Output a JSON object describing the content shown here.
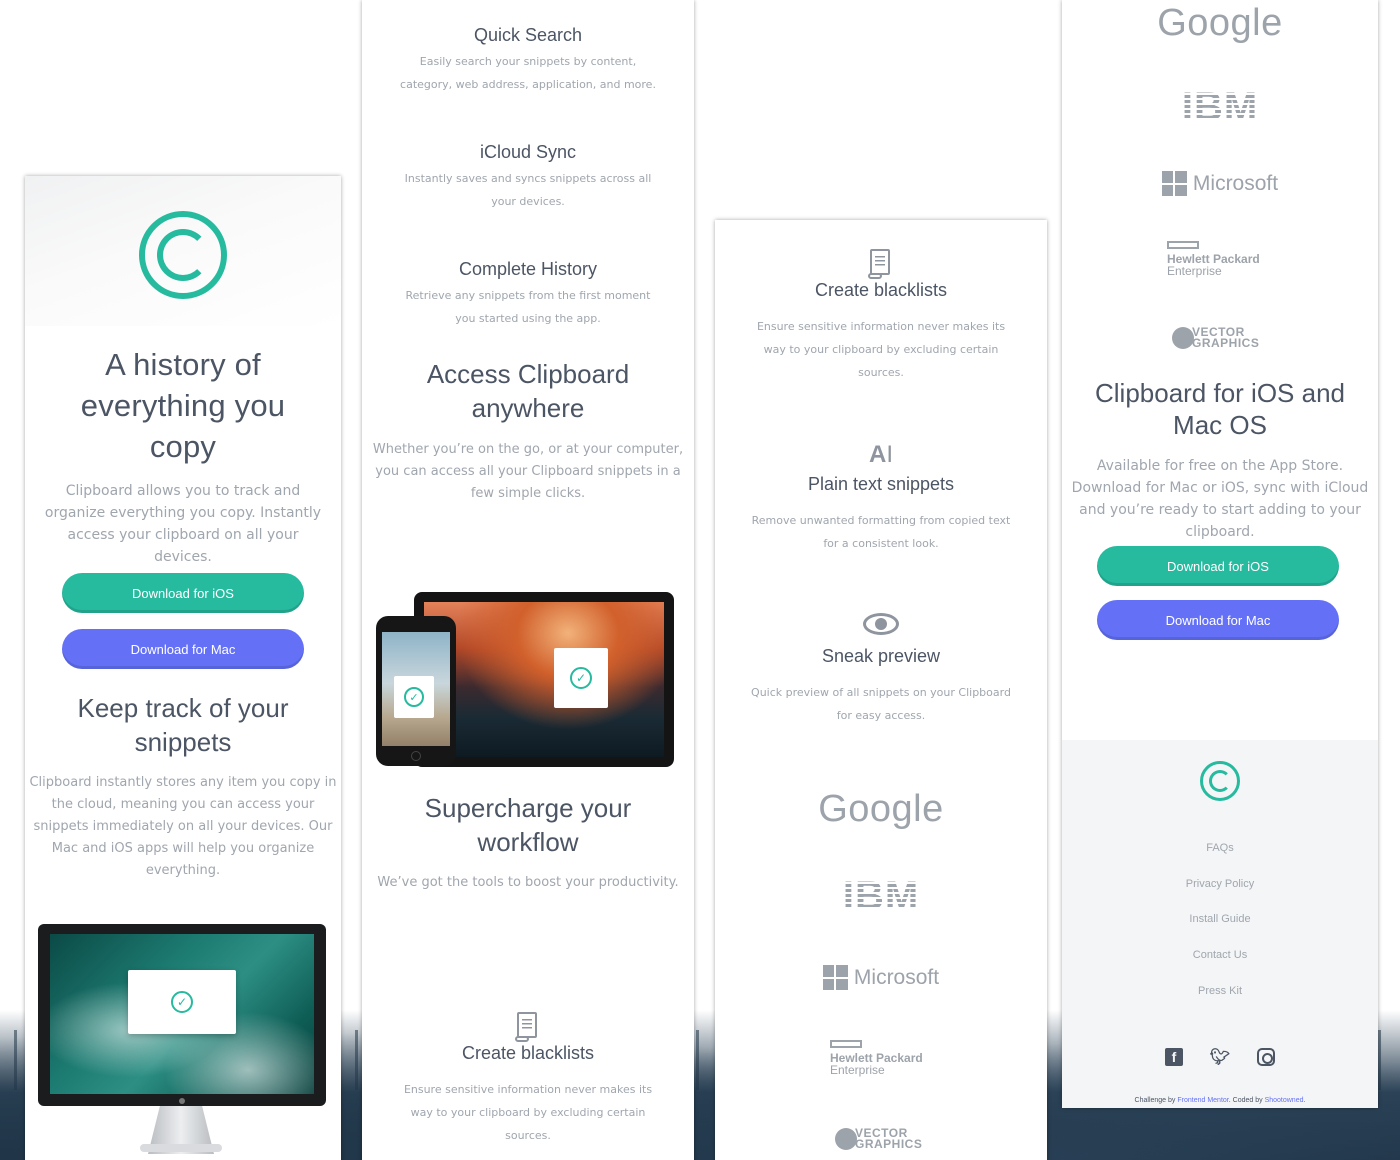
{
  "panel1": {
    "hero_title": "A history of everything you copy",
    "hero_text": "Clipboard allows you to track and organize everything you copy. Instantly access your clipboard on all your devices.",
    "download_ios": "Download for iOS",
    "download_mac": "Download for Mac",
    "track_title": "Keep track of your snippets",
    "track_text": "Clipboard instantly stores any item you copy in the cloud, meaning you can access your snippets immediately on all your devices. Our Mac and iOS apps will help you organize everything."
  },
  "panel2": {
    "features": [
      {
        "title": "Quick Search",
        "text": "Easily search your snippets by content, category, web address, application, and more."
      },
      {
        "title": "iCloud Sync",
        "text": "Instantly saves and syncs snippets across all your devices."
      },
      {
        "title": "Complete History",
        "text": "Retrieve any snippets from the first moment you started using the app."
      }
    ],
    "access_title": "Access Clipboard anywhere",
    "access_text": "Whether you’re on the go, or at your computer, you can access all your Clipboard snippets in a few simple clicks.",
    "supercharge_title": "Supercharge your workflow",
    "supercharge_text": "We’ve got the tools to boost your productivity.",
    "blacklist_title": "Create blacklists",
    "blacklist_text": "Ensure sensitive information never makes its way to your clipboard by excluding certain sources."
  },
  "panel3": {
    "tools": [
      {
        "title": "Create blacklists",
        "text": "Ensure sensitive information never makes its way to your clipboard by excluding certain sources.",
        "icon": "blacklist-icon"
      },
      {
        "title": "Plain text snippets",
        "text": "Remove unwanted formatting from copied text for a consistent look.",
        "icon": "text-icon"
      },
      {
        "title": "Sneak preview",
        "text": "Quick preview of all snippets on your Clipboard for easy access.",
        "icon": "preview-icon"
      }
    ]
  },
  "logos": {
    "google": "Google",
    "ibm": "IBM",
    "microsoft": "Microsoft",
    "hpe_line1": "Hewlett Packard",
    "hpe_line2": "Enterprise",
    "vg_line1": "VECTOR",
    "vg_line2": "GRAPHICS"
  },
  "panel4": {
    "cta_title": "Clipboard for iOS and Mac OS",
    "cta_text": "Available for free on the App Store. Download for Mac or iOS, sync with iCloud and you’re ready to start adding to your clipboard.",
    "download_ios": "Download for iOS",
    "download_mac": "Download for Mac",
    "footer_links": [
      "FAQs",
      "Privacy Policy",
      "Install Guide",
      "Contact Us",
      "Press Kit"
    ],
    "social": [
      "facebook-icon",
      "twitter-icon",
      "instagram-icon"
    ],
    "credit_prefix": "Challenge by",
    "credit_fm": "Frontend Mentor",
    "credit_mid": ". Coded by",
    "credit_author": "Shootowned",
    "credit_end": "."
  },
  "colors": {
    "accent_green": "#26ba9f",
    "accent_blue": "#6471f7",
    "heading": "#4c5564",
    "body": "#a0a6ae",
    "logo_gray": "#9da3aa"
  },
  "check_glyph": "✓"
}
